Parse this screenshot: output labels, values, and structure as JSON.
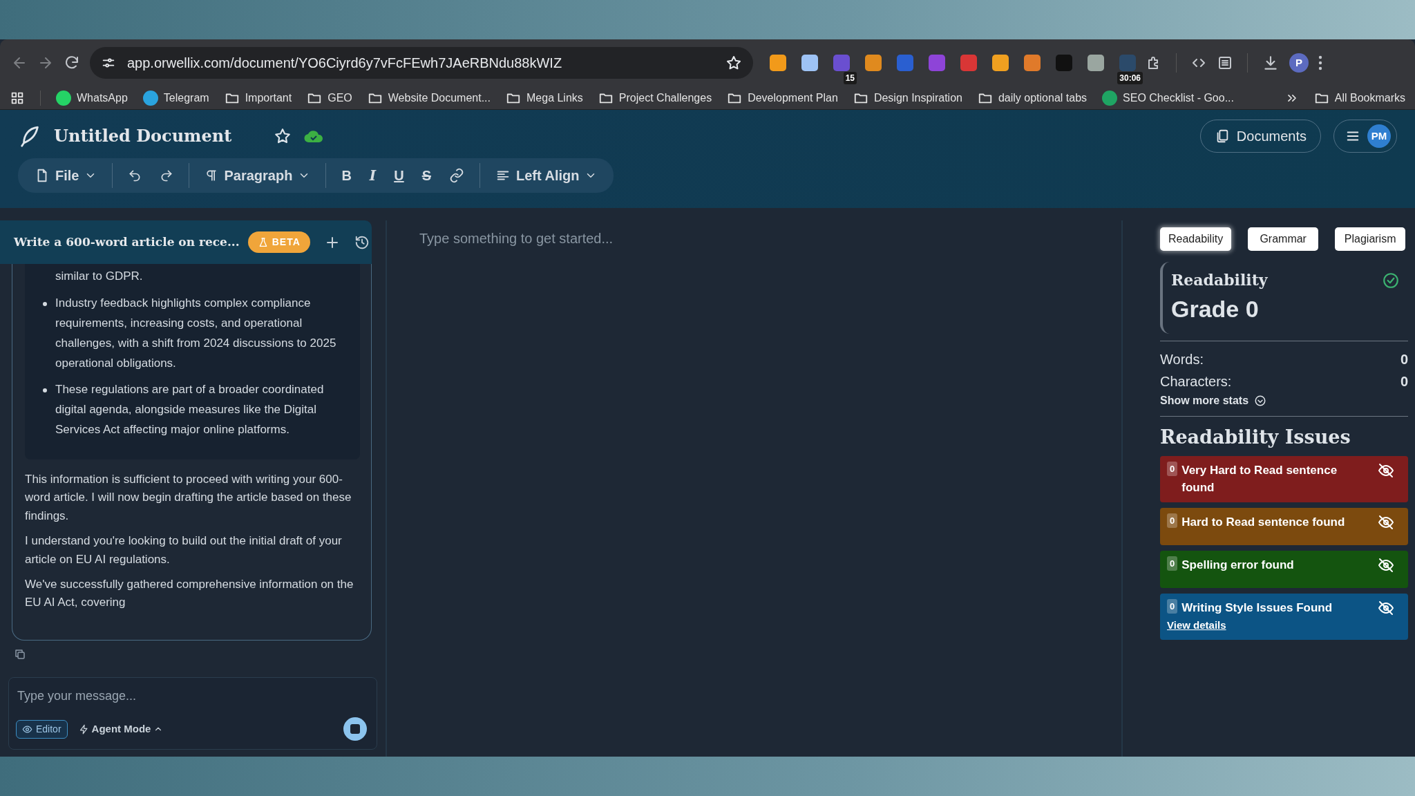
{
  "browser": {
    "url": "app.orwellix.com/document/YO6Ciyrd6y7vFcFEwh7JAeRBNdu88kWIZ",
    "extensions": [
      {
        "color": "#f29a1a"
      },
      {
        "color": "#9ec3f5"
      },
      {
        "color": "#6a4fd0",
        "badge": "15"
      },
      {
        "color": "#e08a1e"
      },
      {
        "color": "#2a5fd0"
      },
      {
        "color": "#8e44d8"
      },
      {
        "color": "#d93636"
      },
      {
        "color": "#f0a020"
      },
      {
        "color": "#e07a2a"
      },
      {
        "color": "#111111"
      },
      {
        "color": "#9aa6a0"
      },
      {
        "color": "#2b4a6a",
        "badge": "30:06"
      }
    ],
    "profile": "P",
    "bookmarks": [
      {
        "kind": "app",
        "label": "WhatsApp",
        "color": "#25d366"
      },
      {
        "kind": "app",
        "label": "Telegram",
        "color": "#2aa3de"
      },
      {
        "kind": "folder",
        "label": "Important"
      },
      {
        "kind": "folder",
        "label": "GEO"
      },
      {
        "kind": "folder",
        "label": "Website Document..."
      },
      {
        "kind": "folder",
        "label": "Mega Links"
      },
      {
        "kind": "folder",
        "label": "Project Challenges"
      },
      {
        "kind": "folder",
        "label": "Development Plan"
      },
      {
        "kind": "folder",
        "label": "Design Inspiration"
      },
      {
        "kind": "folder",
        "label": "daily optional tabs"
      },
      {
        "kind": "app",
        "label": "SEO Checklist - Goo...",
        "color": "#1fa463"
      }
    ],
    "all_bookmarks": "All Bookmarks"
  },
  "app": {
    "title": "Untitled Document",
    "documents_button": "Documents",
    "avatar": "PM",
    "toolbar": {
      "file": "File",
      "paragraph": "Paragraph",
      "align": "Left Align",
      "format_buttons": [
        {
          "kind": "bold",
          "label": "B"
        },
        {
          "kind": "italic",
          "label": "I"
        },
        {
          "kind": "underline",
          "label": "U"
        },
        {
          "kind": "strike",
          "label": "S"
        }
      ]
    }
  },
  "chat": {
    "title": "Write a 600-word article on rece...",
    "badge": "BETA",
    "bullets": [
      "similar to GDPR.",
      "Industry feedback highlights complex compliance requirements, increasing costs, and operational challenges, with a shift from 2024 discussions to 2025 operational obligations.",
      "These regulations are part of a broader coordinated digital agenda, alongside measures like the Digital Services Act affecting major online platforms."
    ],
    "paragraphs": [
      "This information is sufficient to proceed with writing your 600-word article. I will now begin drafting the article based on these findings.",
      "I understand you're looking to build out the initial draft of your article on EU AI regulations.",
      "We've successfully gathered comprehensive information on the EU AI Act, covering"
    ],
    "input": {
      "placeholder": "Type your message..."
    },
    "editor_chip": "Editor",
    "agent_mode": "Agent Mode"
  },
  "editor": {
    "placeholder": "Type something to get started..."
  },
  "panel": {
    "tabs": [
      {
        "label": "Readability",
        "selected": true
      },
      {
        "label": "Grammar",
        "selected": false
      },
      {
        "label": "Plagiarism",
        "selected": false
      }
    ],
    "card_title": "Readability",
    "grade": "Grade 0",
    "stats": [
      {
        "label": "Words:",
        "value": "0"
      },
      {
        "label": "Characters:",
        "value": "0"
      }
    ],
    "show_more": "Show more stats",
    "issues_title": "Readability Issues",
    "issues": [
      {
        "count": "0",
        "label": "Very Hard to Read sentence found",
        "color": "#7f1d1d"
      },
      {
        "count": "0",
        "label": "Hard to Read sentence found",
        "color": "#7c4a0e"
      },
      {
        "count": "0",
        "label": "Spelling error found",
        "color": "#14540f"
      },
      {
        "count": "0",
        "label": "Writing Style Issues Found",
        "color": "#0c5485",
        "link": "View details"
      }
    ]
  }
}
